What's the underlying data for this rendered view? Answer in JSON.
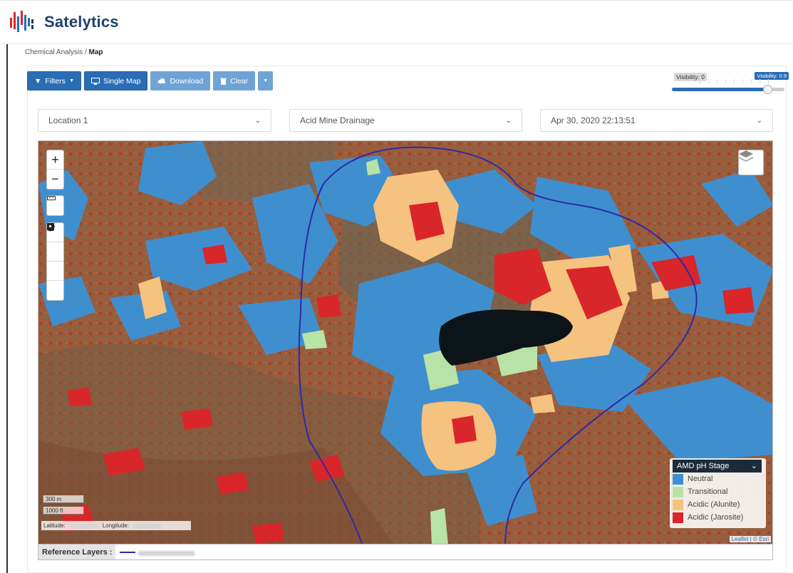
{
  "app": {
    "name": "Satelytics"
  },
  "breadcrumb": {
    "parent": "Chemical Analysis",
    "separator": "/",
    "current": "Map"
  },
  "toolbar": {
    "filters_label": "Filters",
    "single_map_label": "Single Map",
    "download_label": "Download",
    "clear_label": "Clear"
  },
  "visibility": {
    "min_label": "Visibility: 0",
    "max_label": "Visibility: 0.9",
    "value": 0.9
  },
  "selectors": {
    "location": "Location 1",
    "analysis": "Acid Mine Drainage",
    "datetime": "Apr 30, 2020 22:13:51"
  },
  "map": {
    "zoom_in": "+",
    "zoom_out": "−",
    "scale_metric": "300 m",
    "scale_imperial": "1000 ft",
    "latitude_label": "Latitude:",
    "longitude_label": "Longitude:",
    "attribution": "Leaflet | © Esri",
    "icons": [
      "ruler-icon",
      "polygon-icon",
      "rectangle-icon",
      "circle-icon",
      "marker-icon",
      "layers-icon"
    ]
  },
  "legend": {
    "title": "AMD pH Stage",
    "items": [
      {
        "label": "Neutral",
        "color": "#3f8fcf"
      },
      {
        "label": "Transitional",
        "color": "#b9e3a6"
      },
      {
        "label": "Acidic (Alunite)",
        "color": "#f6c27f"
      },
      {
        "label": "Acidic (Jarosite)",
        "color": "#d9262a"
      }
    ]
  },
  "reference_layers": {
    "label": "Reference Layers :"
  },
  "colors": {
    "accent": "#2a6db5",
    "boundary": "#2e2aa8"
  }
}
